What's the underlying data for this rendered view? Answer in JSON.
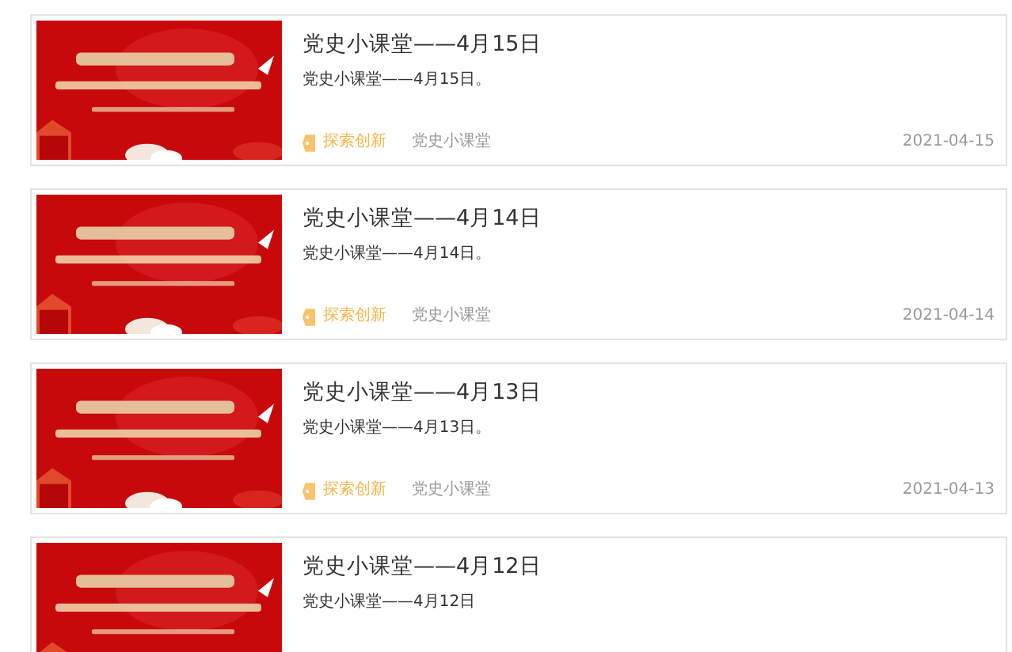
{
  "articles": [
    {
      "title": "党史小课堂——4月15日",
      "summary": "党史小课堂——4月15日。",
      "tag": "探索创新",
      "category": "党史小课堂",
      "date": "2021-04-15"
    },
    {
      "title": "党史小课堂——4月14日",
      "summary": "党史小课堂——4月14日。",
      "tag": "探索创新",
      "category": "党史小课堂",
      "date": "2021-04-14"
    },
    {
      "title": "党史小课堂——4月13日",
      "summary": "党史小课堂——4月13日。",
      "tag": "探索创新",
      "category": "党史小课堂",
      "date": "2021-04-13"
    },
    {
      "title": "党史小课堂——4月12日",
      "summary": "党史小课堂——4月12日"
    }
  ]
}
